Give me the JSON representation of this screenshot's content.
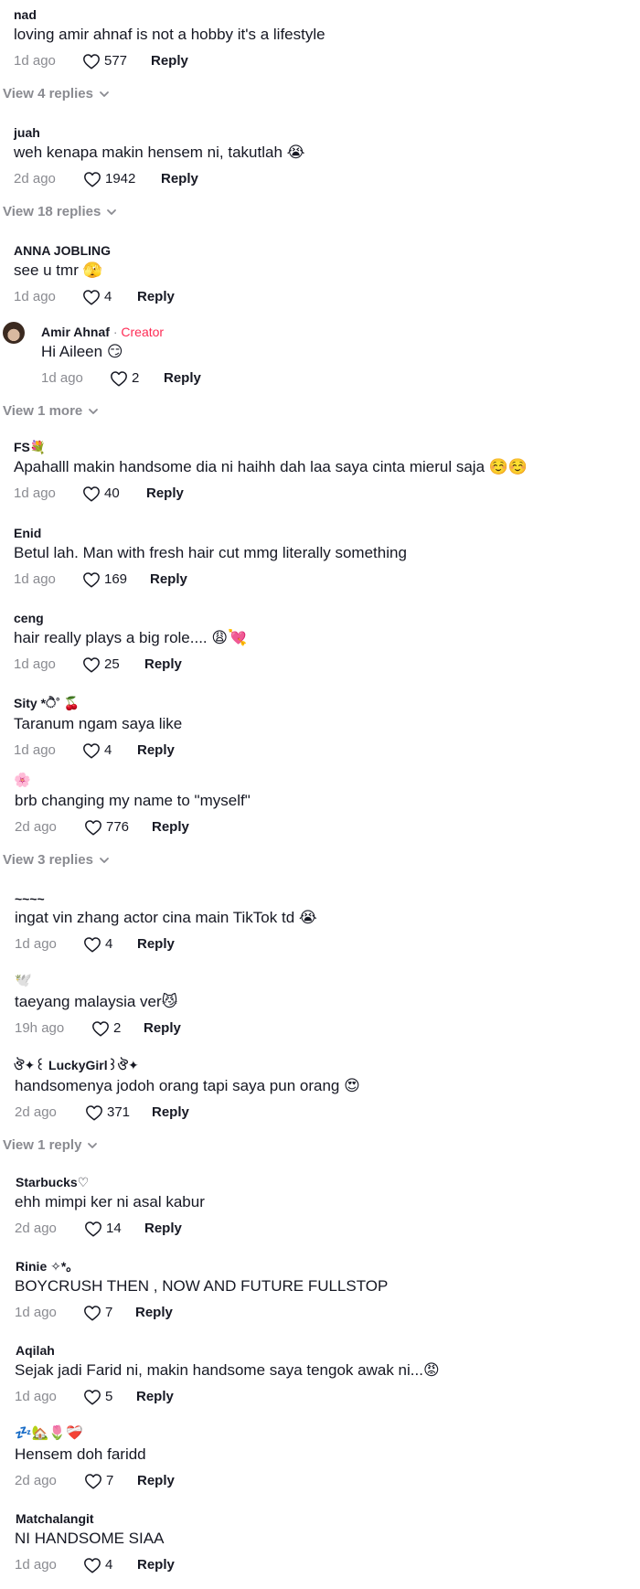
{
  "comments": [
    {
      "user": "nad",
      "text": "loving amir ahnaf is not a hobby it's a lifestyle",
      "date": "1d ago",
      "likes": "577",
      "reply": "Reply"
    },
    {
      "user": "juah",
      "text": "weh kenapa makin hensem ni, takutlah 😭",
      "date": "2d ago",
      "likes": "1942",
      "reply": "Reply"
    },
    {
      "user": "ANNA JOBLING",
      "text": "see u tmr 🫣",
      "date": "1d ago",
      "likes": "4",
      "reply": "Reply"
    },
    {
      "user": "Amir Ahnaf",
      "creator_sep": " · ",
      "creator_label": "Creator",
      "text": "Hi Aileen 😏",
      "date": "1d ago",
      "likes": "2",
      "reply": "Reply"
    },
    {
      "user": "FS💐",
      "text": "Apahalll makin handsome dia ni haihh dah laa saya cinta mierul saja ☺️☺️",
      "date": "1d ago",
      "likes": "40",
      "reply": "Reply"
    },
    {
      "user": "Enid",
      "text": "Betul lah. Man with fresh hair cut mmg literally something",
      "date": "1d ago",
      "likes": "169",
      "reply": "Reply"
    },
    {
      "user": "ceng",
      "text": "hair really plays a big role.... 😩💘",
      "date": "1d ago",
      "likes": "25",
      "reply": "Reply"
    },
    {
      "user": "Sity  *ੈ˚ 🍒",
      "text": "Taranum ngam saya like",
      "date": "1d ago",
      "likes": "4",
      "reply": "Reply"
    },
    {
      "user": "🌸",
      "text": "brb changing my name to \"myself\"",
      "date": "2d ago",
      "likes": "776",
      "reply": "Reply"
    },
    {
      "user": "~~~~",
      "text": "ingat vin zhang actor cina main TikTok td 😭",
      "date": "1d ago",
      "likes": "4",
      "reply": "Reply"
    },
    {
      "user": "🕊️",
      "text": "taeyang malaysia ver😼",
      "date": "19h ago",
      "likes": "2",
      "reply": "Reply"
    },
    {
      "user": "ঔ✦꒰ LuckyGirl꒱ঔ✦",
      "text": "handsomenya jodoh orang tapi saya pun orang 😍",
      "date": "2d ago",
      "likes": "371",
      "reply": "Reply"
    },
    {
      "user": "Starbucks♡",
      "text": "ehh mimpi ker ni asal kabur",
      "date": "2d ago",
      "likes": "14",
      "reply": "Reply"
    },
    {
      "user": "Rinie ✧*｡",
      "text": "BOYCRUSH THEN , NOW AND FUTURE FULLSTOP",
      "date": "1d ago",
      "likes": "7",
      "reply": "Reply"
    },
    {
      "user": "Aqilah",
      "text": "Sejak jadi Farid ni, makin handsome saya tengok awak ni...😡",
      "date": "1d ago",
      "likes": "5",
      "reply": "Reply"
    },
    {
      "user": "💤🏡🌷❤️‍🩹",
      "text": "Hensem doh faridd",
      "date": "2d ago",
      "likes": "7",
      "reply": "Reply"
    },
    {
      "user": "Matchalangit",
      "text": "NI HANDSOME SIAA",
      "date": "1d ago",
      "likes": "4",
      "reply": "Reply"
    }
  ],
  "view_more": [
    {
      "label": "View 4 replies"
    },
    {
      "label": "View 18 replies"
    },
    {
      "label": "View 1 more"
    },
    {
      "label": "View 3 replies"
    },
    {
      "label": "View 1 reply"
    }
  ],
  "colors": {
    "text": "#161823",
    "muted": "#8a8b91",
    "creator": "#fe2c55"
  },
  "icons": {
    "like": "heart-outline-icon",
    "expand": "chevron-down-icon"
  }
}
